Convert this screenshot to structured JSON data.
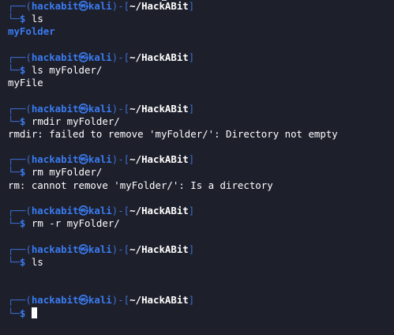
{
  "prompt": {
    "user": "hackabit",
    "skull": "㉿",
    "host": "kali",
    "path": "~/HackABit",
    "symbol": "$"
  },
  "blocks": [
    {
      "command": "ls",
      "output": "myFolder",
      "output_type": "directory"
    },
    {
      "command": "ls myFolder/",
      "output": "myFile",
      "output_type": "text"
    },
    {
      "command": "rmdir myFolder/",
      "output": "rmdir: failed to remove 'myFolder/': Directory not empty",
      "output_type": "text"
    },
    {
      "command": "rm myFolder/",
      "output": "rm: cannot remove 'myFolder/': Is a directory",
      "output_type": "text"
    },
    {
      "command": "rm -r myFolder/",
      "output": "",
      "output_type": "none"
    },
    {
      "command": "ls",
      "output": "",
      "output_type": "none"
    },
    {
      "command": "",
      "output": "",
      "output_type": "cursor"
    }
  ],
  "colors": {
    "background": "#1d1f2b",
    "prompt_blue": "#3a7bf0",
    "box_blue": "#3b6fd1",
    "text": "#ffffff"
  }
}
